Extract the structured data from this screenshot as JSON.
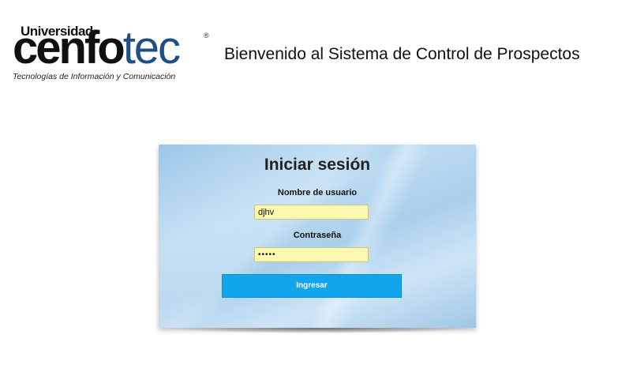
{
  "header": {
    "logo": {
      "universidad": "Universidad",
      "cenfo": "cenfo",
      "tec": "tec",
      "registered": "®",
      "tagline": "Tecnologías de Información y Comunicación"
    },
    "title": "Bienvenido al Sistema de Control de Prospectos"
  },
  "login": {
    "title": "Iniciar sesión",
    "username_label": "Nombre de usuario",
    "username_value": "djhv",
    "password_label": "Contraseña",
    "password_value": "•••••",
    "submit_label": "Ingresar"
  },
  "colors": {
    "panel": "#a9cfec",
    "field_bg": "#fbf8b0",
    "button": "#12a5ee",
    "logo_tec": "#1f4f84"
  }
}
